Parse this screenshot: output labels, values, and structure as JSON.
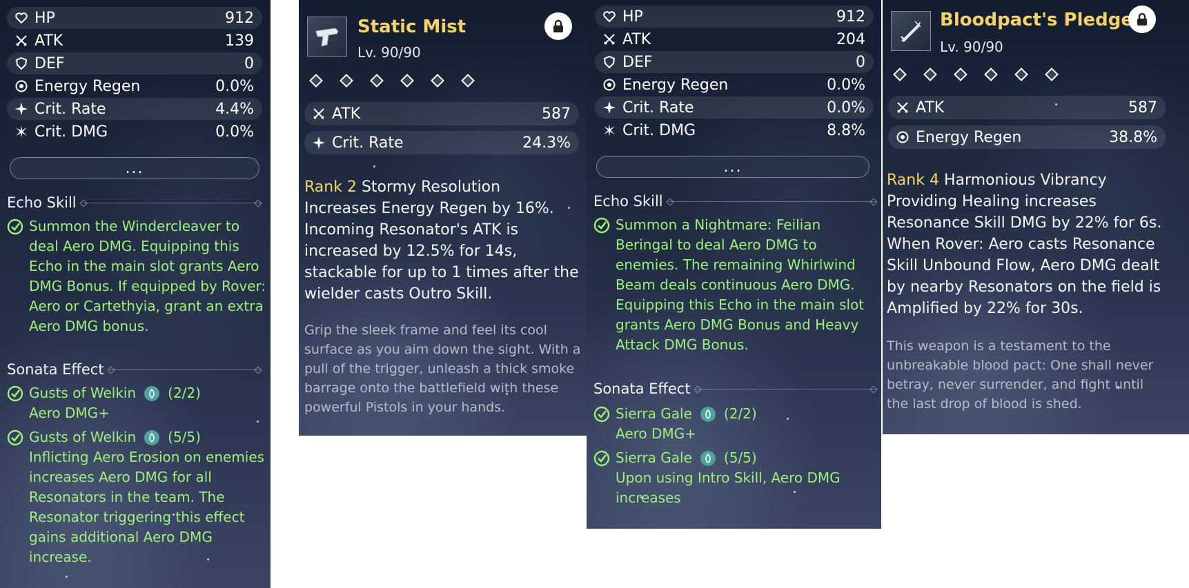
{
  "echo_cards": [
    {
      "stats": [
        {
          "icon": "heart-icon",
          "name": "HP",
          "value": "912"
        },
        {
          "icon": "swords-icon",
          "name": "ATK",
          "value": "139"
        },
        {
          "icon": "shield-icon",
          "name": "DEF",
          "value": "0"
        },
        {
          "icon": "energy-icon",
          "name": "Energy Regen",
          "value": "0.0%"
        },
        {
          "icon": "crit-rate-icon",
          "name": "Crit. Rate",
          "value": "4.4%"
        },
        {
          "icon": "crit-dmg-icon",
          "name": "Crit. DMG",
          "value": "0.0%"
        }
      ],
      "more_label": "...",
      "echo_skill_header": "Echo Skill",
      "echo_skill_text": "Summon the Windercleaver to deal Aero DMG. Equipping this Echo in the main slot grants Aero DMG Bonus. If equipped by Rover: Aero or Cartethyia, grant an extra Aero DMG bonus.",
      "sonata_header": "Sonata Effect",
      "sonata_effects": [
        {
          "name": "Gusts of Welkin",
          "count": "(2/2)",
          "text": "Aero DMG+"
        },
        {
          "name": "Gusts of Welkin",
          "count": "(5/5)",
          "text": "Inflicting Aero Erosion on enemies increases Aero DMG for all Resonators in the team. The Resonator triggering this effect gains additional Aero DMG increase."
        }
      ]
    },
    {
      "stats": [
        {
          "icon": "heart-icon",
          "name": "HP",
          "value": "912"
        },
        {
          "icon": "swords-icon",
          "name": "ATK",
          "value": "204"
        },
        {
          "icon": "shield-icon",
          "name": "DEF",
          "value": "0"
        },
        {
          "icon": "energy-icon",
          "name": "Energy Regen",
          "value": "0.0%"
        },
        {
          "icon": "crit-rate-icon",
          "name": "Crit. Rate",
          "value": "0.0%"
        },
        {
          "icon": "crit-dmg-icon",
          "name": "Crit. DMG",
          "value": "8.8%"
        }
      ],
      "more_label": "...",
      "echo_skill_header": "Echo Skill",
      "echo_skill_text": "Summon a Nightmare: Feilian Beringal to deal Aero DMG to enemies. The remaining Whirlwind Beam deals continuous Aero DMG. Equipping this Echo in the main slot grants Aero DMG Bonus and Heavy Attack DMG Bonus.",
      "sonata_header": "Sonata Effect",
      "sonata_effects": [
        {
          "name": "Sierra Gale",
          "count": "(2/2)",
          "text": "Aero DMG+"
        },
        {
          "name": "Sierra Gale",
          "count": "(5/5)",
          "text": "Upon using Intro Skill, Aero DMG increases"
        }
      ]
    }
  ],
  "weapon_cards": [
    {
      "name": "Static Mist",
      "level": "Lv. 90/90",
      "icon": "pistol-icon",
      "rank_diamonds": 6,
      "stats": [
        {
          "icon": "swords-icon",
          "name": "ATK",
          "value": "587"
        },
        {
          "icon": "crit-rate-icon",
          "name": "Crit. Rate",
          "value": "24.3%"
        }
      ],
      "rank_label": "Rank 2",
      "passive_name": "Stormy Resolution",
      "passive_text": "Increases Energy Regen by 16%. Incoming Resonator's ATK is increased by 12.5% for 14s, stackable for up to 1 times after the wielder casts Outro Skill.",
      "lore": "Grip the sleek frame and feel its cool surface as you aim down the sight. With a pull of the trigger, unleash a thick smoke barrage onto the battlefield with these powerful Pistols in your hands."
    },
    {
      "name": "Bloodpact's Pledge",
      "level": "Lv. 90/90",
      "icon": "sword-icon",
      "rank_diamonds": 6,
      "stats": [
        {
          "icon": "swords-icon",
          "name": "ATK",
          "value": "587"
        },
        {
          "icon": "energy-icon",
          "name": "Energy Regen",
          "value": "38.8%"
        }
      ],
      "rank_label": "Rank 4",
      "passive_name": "Harmonious Vibrancy",
      "passive_text": "Providing Healing increases Resonance Skill DMG by 22% for 6s. When Rover: Aero casts Resonance Skill Unbound Flow, Aero DMG dealt by nearby Resonators on the field is Amplified by 22% for 30s.",
      "lore": "This weapon is a testament to the unbreakable blood pact: One shall never betray, never surrender, and fight until the last drop of blood is shed."
    }
  ],
  "colors": {
    "accent_gold": "#f4d468",
    "effect_green": "#9ef07a",
    "lore_gray": "#b5bcc9",
    "sonata_teal": "#4fa39a"
  }
}
